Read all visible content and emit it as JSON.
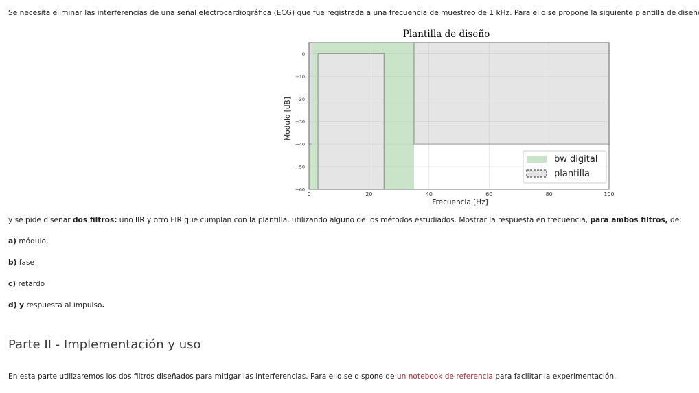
{
  "intro": "Se necesita eliminar las interferencias de una señal electrocardiográfica (ECG) que fue registrada a una frecuencia de muestreo de 1 kHz. Para ello se propone la siguiente plantilla de diseño:",
  "chart_data": {
    "type": "area",
    "title": "Plantilla de diseño",
    "xlabel": "Frecuencia [Hz]",
    "ylabel": "Modulo [dB]",
    "xlim": [
      0,
      100
    ],
    "ylim": [
      -60,
      5
    ],
    "xticks": [
      "0",
      "20",
      "40",
      "60",
      "80",
      "100"
    ],
    "yticks": [
      "0",
      "−10",
      "−20",
      "−30",
      "−40",
      "−50",
      "−60"
    ],
    "grid": true,
    "legend_position": "lower-right",
    "series": [
      {
        "name": "bw digital",
        "color": "#c9e4c9",
        "x": [
          0,
          35
        ],
        "y": [
          -60,
          5
        ]
      },
      {
        "name": "plantilla",
        "color": "#888888",
        "regions": [
          {
            "x": [
              0,
              1
            ],
            "y": [
              -40,
              5
            ]
          },
          {
            "x": [
              3,
              25
            ],
            "y": [
              -60,
              0
            ]
          },
          {
            "x": [
              35,
              100
            ],
            "y": [
              -40,
              5
            ]
          }
        ]
      }
    ]
  },
  "req": {
    "pre": "y se pide diseñar ",
    "bold1": "dos filtros:",
    "mid": " uno IIR y otro FIR que cumplan con la plantilla, utilizando alguno de los métodos estudiados. Mostrar la respuesta en frecuencia, ",
    "bold2": "para ambos filtros,",
    "post": " de:"
  },
  "items": [
    {
      "label": "a)",
      "text": " módulo,"
    },
    {
      "label": "b)",
      "text": " fase"
    },
    {
      "label": "c)",
      "text": " retardo"
    },
    {
      "label": "d)",
      "label2": " y",
      "text": " respuesta al impulso",
      "end": "."
    }
  ],
  "heading": "Parte II - Implementación y uso",
  "p2": {
    "pre": "En esta parte utilizaremos los dos filtros diseñados para mitigar las interferencias. Para ello se dispone de ",
    "link": "un notebook de referencia",
    "post": " para facilitar la experimentación."
  }
}
